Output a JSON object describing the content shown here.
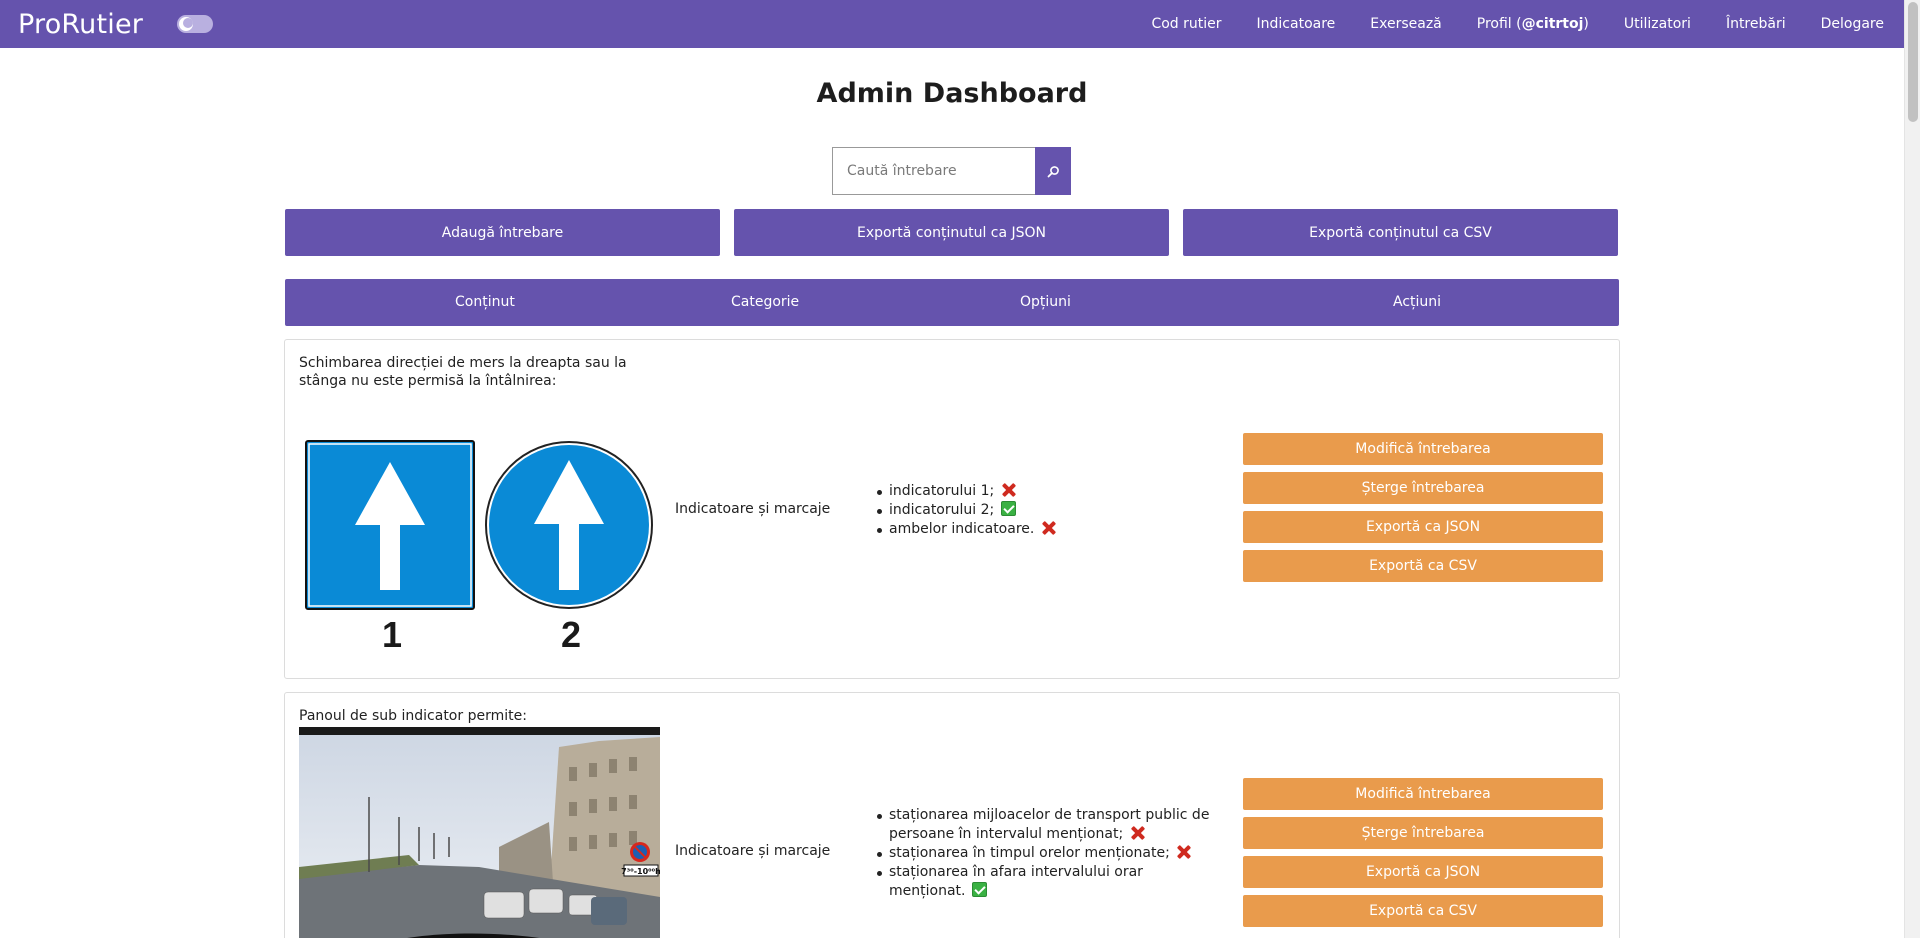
{
  "navbar": {
    "brand": "ProRutier",
    "links": {
      "cod_rutier": "Cod rutier",
      "indicatoare": "Indicatoare",
      "exerseaza": "Exersează",
      "profil_prefix": "Profil (",
      "profil_user": "@citrtoj",
      "profil_suffix": ")",
      "utilizatori": "Utilizatori",
      "intrebari": "Întrebări",
      "delogare": "Delogare"
    }
  },
  "page": {
    "title": "Admin Dashboard"
  },
  "search": {
    "placeholder": "Caută întrebare",
    "value": ""
  },
  "toolbar": {
    "add_question": "Adaugă întrebare",
    "export_json": "Exportă conținutul ca JSON",
    "export_csv": "Exportă conținutul ca CSV"
  },
  "table": {
    "headers": {
      "content": "Conținut",
      "category": "Categorie",
      "options": "Opțiuni",
      "actions": "Acțiuni"
    }
  },
  "questions": [
    {
      "text": "Schimbarea direcției de mers la dreapta sau la stânga nu este permisă la întâlnirea:",
      "image_labels": [
        "1",
        "2"
      ],
      "category": "Indicatoare și marcaje",
      "options": [
        {
          "text": "indicatorului 1;",
          "correct": false
        },
        {
          "text": "indicatorului 2;",
          "correct": true
        },
        {
          "text": "ambelor indicatoare.",
          "correct": false
        }
      ],
      "actions": {
        "edit": "Modifică întrebarea",
        "delete": "Șterge întrebarea",
        "export_json": "Exportă ca JSON",
        "export_csv": "Exportă ca CSV"
      }
    },
    {
      "text": "Panoul de sub indicator permite:",
      "image_sign_text": "7³⁰-10⁰⁰h",
      "category": "Indicatoare și marcaje",
      "options": [
        {
          "text": "staționarea mijloacelor de transport public de persoane în intervalul menționat;",
          "correct": false
        },
        {
          "text": "staționarea în timpul orelor menționate;",
          "correct": false
        },
        {
          "text": "staționarea în afara intervalului orar menționat.",
          "correct": true
        }
      ],
      "actions": {
        "edit": "Modifică întrebarea",
        "delete": "Șterge întrebarea",
        "export_json": "Exportă ca JSON",
        "export_csv": "Exportă ca CSV"
      }
    }
  ],
  "colors": {
    "primary": "#6553ad",
    "action": "#e99b4c",
    "sign_blue": "#0a8ad6",
    "wrong": "#cf2a1f",
    "right": "#3ab143"
  }
}
